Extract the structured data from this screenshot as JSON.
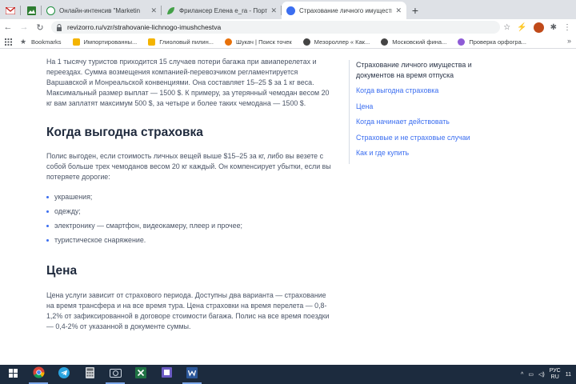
{
  "tabs": [
    {
      "title": "",
      "color": "#c5221f",
      "kind": "gmail"
    },
    {
      "title": "",
      "color": "#2e7d32",
      "kind": "sheet"
    },
    {
      "title": "Онлайн-интенсив \"Marketin",
      "color": "#1e8e3e",
      "kind": "site"
    },
    {
      "title": "Фрилансер Елена e_ra - Портф",
      "color": "#43a047",
      "kind": "site"
    },
    {
      "title": "Страхование личного имуществ",
      "color": "#3b6ef0",
      "kind": "site",
      "active": true
    }
  ],
  "address": {
    "url": "revizorro.ru/vzr/strahovanie-lichnogo-imushchestva"
  },
  "bookmarks": [
    {
      "label": "Bookmarks",
      "color": "#5f6368"
    },
    {
      "label": "Импортированны...",
      "color": "#f4b400"
    },
    {
      "label": "Глиоловый пилин...",
      "color": "#f4b400"
    },
    {
      "label": "Шукач | Поиск точек",
      "color": "#e8710a"
    },
    {
      "label": "Мезороллер « Как...",
      "color": "#444444"
    },
    {
      "label": "Московский фина...",
      "color": "#444444"
    },
    {
      "label": "Проверка орфогра...",
      "color": "#8e5bd6"
    }
  ],
  "article": {
    "intro": "На 1 тысячу туристов приходится 15 случаев потери багажа при авиаперелетах и переездах. Сумма возмещения компанией-перевозчиком регламентируется Варшавской и Монреальской конвенциями. Она составляет 15–25 $ за 1 кг веса. Максимальный размер выплат — 1500 $. К примеру, за утерянный чемодан весом 20 кг вам заплатят максимум 500 $, за четыре и более таких чемодана — 1500 $.",
    "section1_title": "Когда выгодна страховка",
    "section1_text": "Полис выгоден, если стоимость личных вещей выше $15–25 за кг, либо вы везете с собой больше трех чемоданов весом 20 кг каждый. Он компенсирует убытки, если вы потеряете дорогие:",
    "list": [
      "украшения;",
      "одежду;",
      "электронику — смартфон, видеокамеру, плеер и прочее;",
      "туристическое снаряжение."
    ],
    "section2_title": "Цена",
    "section2_text": "Цена услуги зависит от страхового периода. Доступны два варианта — страхование на время трансфера и на все время тура. Цена страховки на время перелета — 0,8-1,2% от зафиксированной в договоре стоимости багажа. Полис на все время поездки — 0,4-2% от указанной в документе суммы."
  },
  "toc": {
    "heading": "Страхование личного имущества и документов на время отпуска",
    "links": [
      "Когда выгодна страховка",
      "Цена",
      "Когда начинает действовать",
      "Страховые и не страховые случаи",
      "Как и где купить"
    ]
  },
  "taskbar": {
    "lang": "РУС",
    "lang2": "RU",
    "time": "11"
  }
}
